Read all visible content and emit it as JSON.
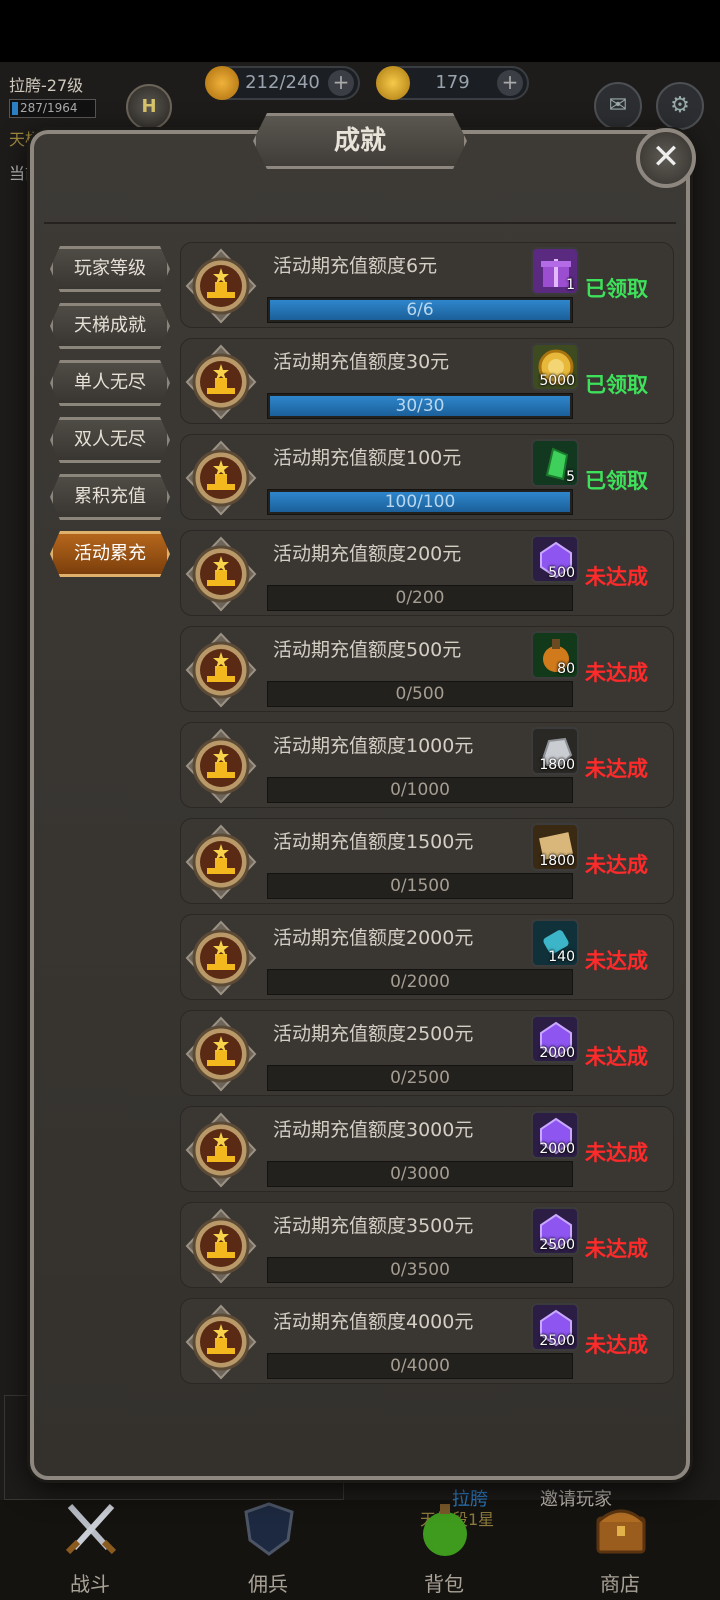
{
  "hud": {
    "player": "拉胯-27级",
    "xp": "287/1964",
    "rank_letter": "H",
    "energy": "212/240",
    "gold": "179",
    "side_a": "天梯",
    "side_b": "当前"
  },
  "modal": {
    "title": "成就",
    "close": "✕"
  },
  "categories": [
    {
      "label": "玩家等级",
      "active": false
    },
    {
      "label": "天梯成就",
      "active": false
    },
    {
      "label": "单人无尽",
      "active": false
    },
    {
      "label": "双人无尽",
      "active": false
    },
    {
      "label": "累积充值",
      "active": false
    },
    {
      "label": "活动累充",
      "active": true
    }
  ],
  "achievements": [
    {
      "title": "活动期充值额度6元",
      "progress": "6/6",
      "fraction": 1,
      "reward_icon": "purple-gift-icon",
      "reward_count": "1",
      "status": "已领取",
      "claimed": true
    },
    {
      "title": "活动期充值额度30元",
      "progress": "30/30",
      "fraction": 1,
      "reward_icon": "gold-coin-icon",
      "reward_count": "5000",
      "status": "已领取",
      "claimed": true
    },
    {
      "title": "活动期充值额度100元",
      "progress": "100/100",
      "fraction": 1,
      "reward_icon": "green-crystal-icon",
      "reward_count": "5",
      "status": "已领取",
      "claimed": true
    },
    {
      "title": "活动期充值额度200元",
      "progress": "0/200",
      "fraction": 0,
      "reward_icon": "purple-gem-icon",
      "reward_count": "500",
      "status": "未达成",
      "claimed": false
    },
    {
      "title": "活动期充值额度500元",
      "progress": "0/500",
      "fraction": 0,
      "reward_icon": "potion-icon",
      "reward_count": "80",
      "status": "未达成",
      "claimed": false
    },
    {
      "title": "活动期充值额度1000元",
      "progress": "0/1000",
      "fraction": 0,
      "reward_icon": "silver-ore-icon",
      "reward_count": "1800",
      "status": "未达成",
      "claimed": false
    },
    {
      "title": "活动期充值额度1500元",
      "progress": "0/1500",
      "fraction": 0,
      "reward_icon": "scroll-icon",
      "reward_count": "1800",
      "status": "未达成",
      "claimed": false
    },
    {
      "title": "活动期充值额度2000元",
      "progress": "0/2000",
      "fraction": 0,
      "reward_icon": "blue-crystal-icon",
      "reward_count": "140",
      "status": "未达成",
      "claimed": false
    },
    {
      "title": "活动期充值额度2500元",
      "progress": "0/2500",
      "fraction": 0,
      "reward_icon": "purple-gem-icon",
      "reward_count": "2000",
      "status": "未达成",
      "claimed": false
    },
    {
      "title": "活动期充值额度3000元",
      "progress": "0/3000",
      "fraction": 0,
      "reward_icon": "purple-gem-icon",
      "reward_count": "2000",
      "status": "未达成",
      "claimed": false
    },
    {
      "title": "活动期充值额度3500元",
      "progress": "0/3500",
      "fraction": 0,
      "reward_icon": "purple-gem-icon",
      "reward_count": "2500",
      "status": "未达成",
      "claimed": false
    },
    {
      "title": "活动期充值额度4000元",
      "progress": "0/4000",
      "fraction": 0,
      "reward_icon": "purple-gem-icon",
      "reward_count": "2500",
      "status": "未达成",
      "claimed": false
    }
  ],
  "under": {
    "player_link": "拉胯",
    "invite": "邀请玩家",
    "sub": "天梯段1星"
  },
  "bottom_nav": [
    {
      "label": "战斗",
      "icon": "crossed-swords-icon"
    },
    {
      "label": "佣兵",
      "icon": "shield-icon"
    },
    {
      "label": "背包",
      "icon": "potion-flask-icon"
    },
    {
      "label": "商店",
      "icon": "treasure-chest-icon"
    }
  ],
  "colors": {
    "claimed": "#3de25a",
    "pending": "#ff2a2a",
    "progress_fill": "#2f86cc",
    "active_tab": "#b5661c"
  }
}
